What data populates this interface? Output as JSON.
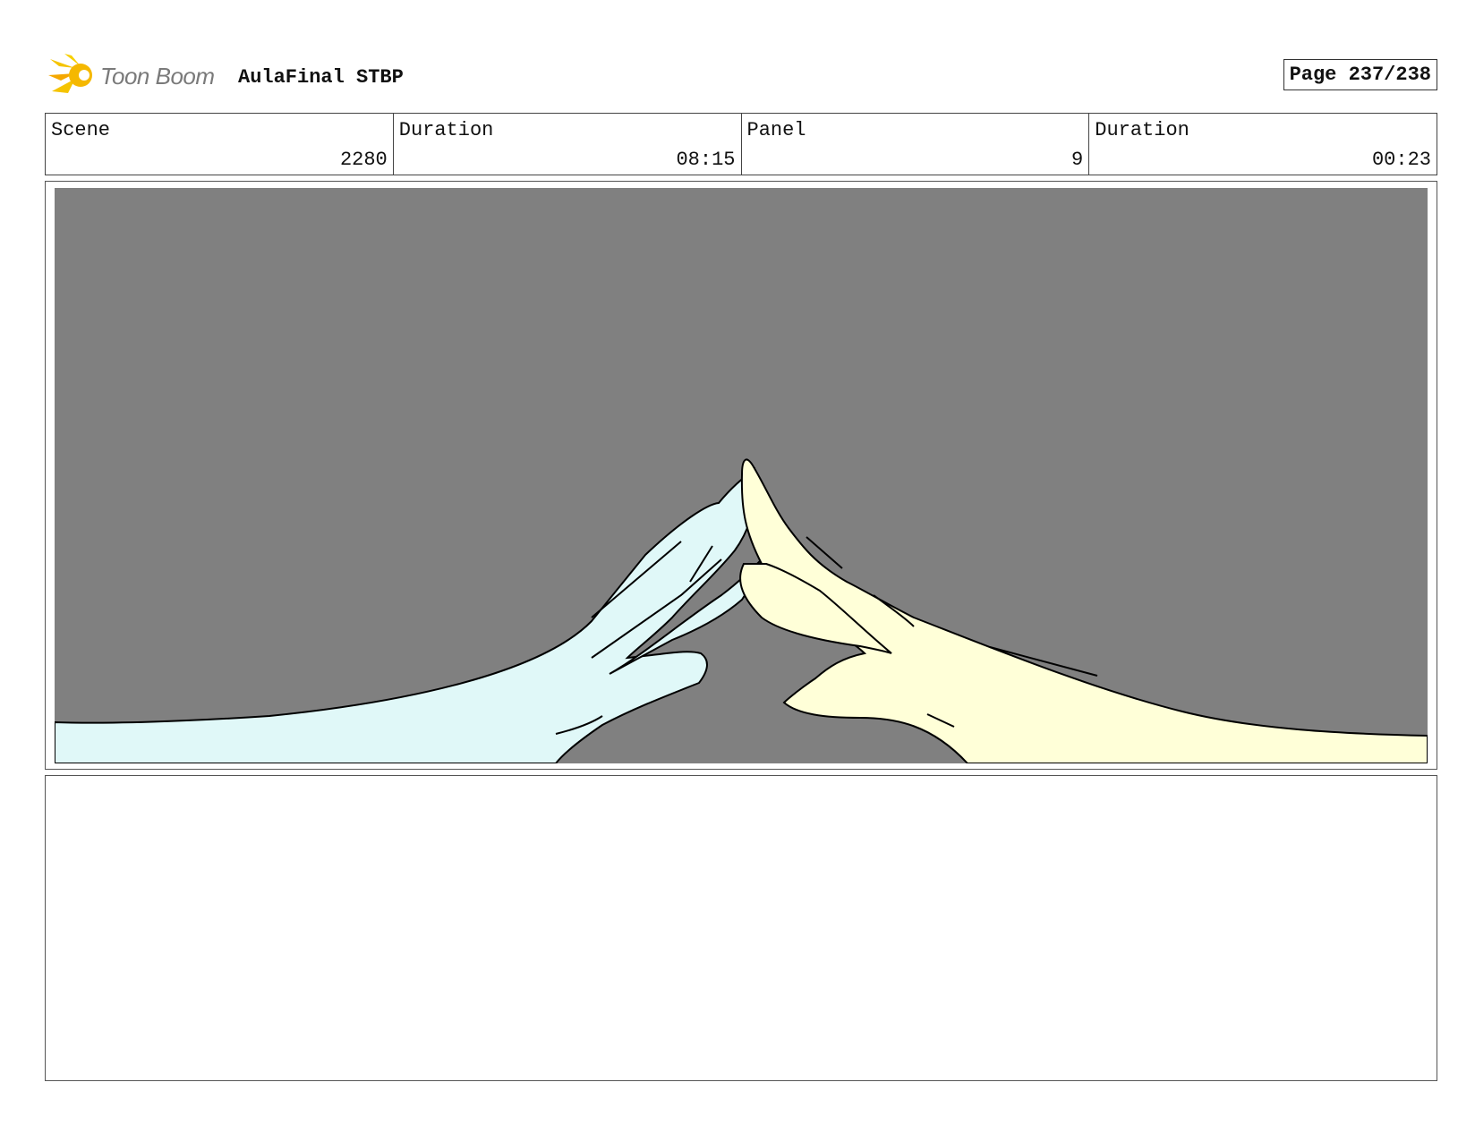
{
  "header": {
    "logo_text": "Toon Boom",
    "project_title": "AulaFinal STBP",
    "page_label": "Page 237/238"
  },
  "info": {
    "scene_label": "Scene",
    "scene_value": "2280",
    "scene_duration_label": "Duration",
    "scene_duration_value": "08:15",
    "panel_label": "Panel",
    "panel_value": "9",
    "panel_duration_label": "Duration",
    "panel_duration_value": "00:23"
  },
  "panel": {
    "background_color": "#808080",
    "left_hand_color": "#e0f8f8",
    "right_hand_color": "#ffffd8"
  },
  "notes": {
    "text": ""
  }
}
